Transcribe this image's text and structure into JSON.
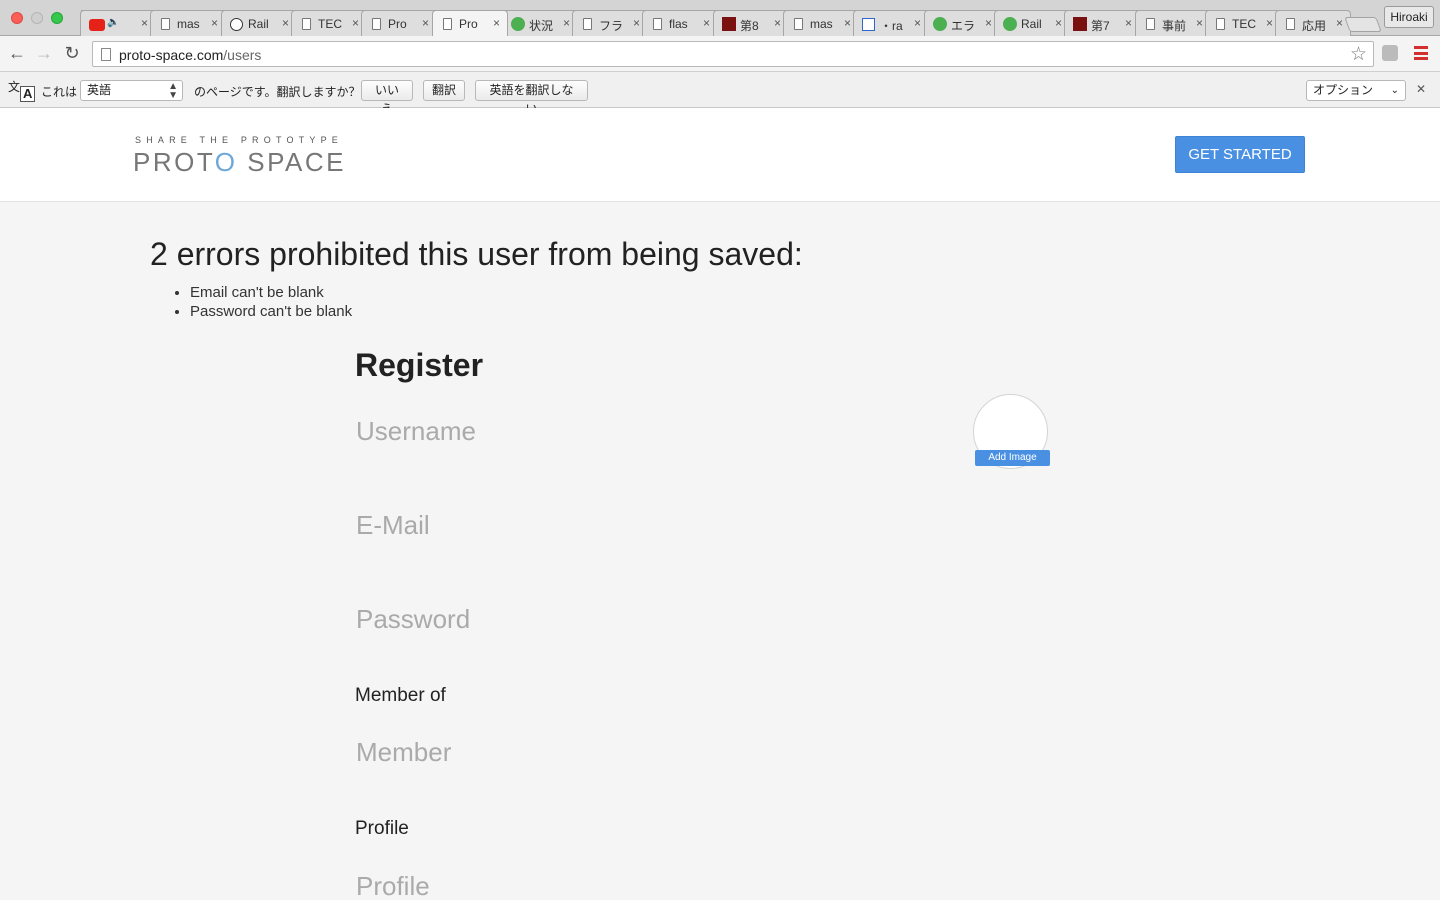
{
  "browser": {
    "tabs": [
      {
        "label": "",
        "icon": "youtube-icon",
        "active": false,
        "audio": true
      },
      {
        "label": "mas",
        "icon": "document-icon",
        "active": false
      },
      {
        "label": "Rail",
        "icon": "info-icon",
        "active": false
      },
      {
        "label": "TEC",
        "icon": "document-icon",
        "active": false
      },
      {
        "label": "Pro",
        "icon": "document-icon",
        "active": false
      },
      {
        "label": "Pro",
        "icon": "document-icon",
        "active": true
      },
      {
        "label": "状況",
        "icon": "green-circle-icon",
        "active": false
      },
      {
        "label": "フラ",
        "icon": "document-icon",
        "active": false
      },
      {
        "label": "flas",
        "icon": "document-icon",
        "active": false
      },
      {
        "label": "第8",
        "icon": "dark-red-icon",
        "active": false
      },
      {
        "label": "mas",
        "icon": "document-icon",
        "active": false
      },
      {
        "label": "・ra",
        "icon": "blue-square-icon",
        "active": false
      },
      {
        "label": "エラ",
        "icon": "green-circle-icon",
        "active": false
      },
      {
        "label": "Rail",
        "icon": "green-circle-icon",
        "active": false
      },
      {
        "label": "第7",
        "icon": "dark-red-icon",
        "active": false
      },
      {
        "label": "事前",
        "icon": "document-icon",
        "active": false
      },
      {
        "label": "TEC",
        "icon": "document-icon",
        "active": false
      },
      {
        "label": "応用",
        "icon": "document-icon",
        "active": false
      }
    ],
    "profile_name": "Hiroaki",
    "url_host": "proto-space.com",
    "url_path": "/users"
  },
  "translate_bar": {
    "prefix": "これは",
    "language": "英語",
    "suffix": "のページです。翻訳しますか？",
    "no_button": "いいえ",
    "translate_button": "翻訳",
    "never_button": "英語を翻訳しない",
    "options": "オプション"
  },
  "site": {
    "logo_tagline": "SHARE THE PROTOTYPE",
    "logo_part1": "PROT",
    "logo_part2": "O",
    "logo_part3": " SPACE",
    "cta": "GET STARTED"
  },
  "errors": {
    "title": "2 errors prohibited this user from being saved:",
    "items": [
      "Email can't be blank",
      "Password can't be blank"
    ]
  },
  "form": {
    "title": "Register",
    "username_placeholder": "Username",
    "email_placeholder": "E-Mail",
    "password_placeholder": "Password",
    "member_label": "Member of",
    "member_placeholder": "Member",
    "profile_label": "Profile",
    "profile_placeholder": "Profile",
    "add_image": "Add Image"
  },
  "colors": {
    "primary": "#4a90e2",
    "logo_accent": "#6fa7d8"
  }
}
